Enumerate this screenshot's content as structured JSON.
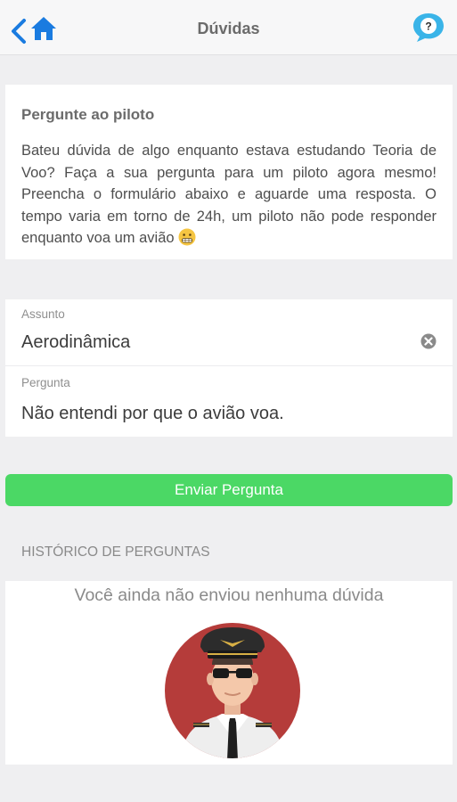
{
  "header": {
    "title": "Dúvidas",
    "back_icon": "chevron-left-icon",
    "home_icon": "home-icon",
    "help_icon": "question-bubble-icon",
    "accent_color": "#1a7be0",
    "help_color": "#3ab4e8"
  },
  "intro": {
    "title": "Pergunte ao piloto",
    "text": "Bateu dúvida de algo enquanto estava estudando Teoria de Voo? Faça a sua pergunta para um piloto agora mesmo! Preencha o formulário abaixo e aguarde uma resposta. O tempo varia em torno de 24h, um piloto não pode responder enquanto voa um avião",
    "emoji_icon": "grimacing-face-icon"
  },
  "form": {
    "subject_label": "Assunto",
    "subject_value": "Aerodinâmica",
    "question_label": "Pergunta",
    "question_value": "Não entendi por que o avião voa."
  },
  "actions": {
    "send_label": "Enviar Pergunta",
    "send_color": "#4bd865"
  },
  "history": {
    "header": "HISTÓRICO DE PERGUNTAS",
    "empty_message": "Você ainda não enviou nenhuma dúvida",
    "illustration": "pilot-avatar-icon"
  }
}
